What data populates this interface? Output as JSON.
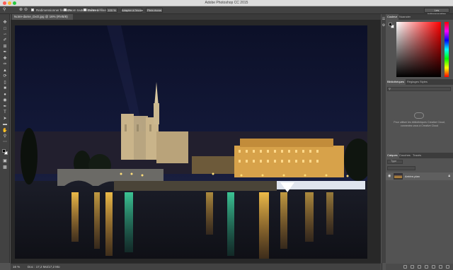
{
  "window": {
    "title": "Adobe Photoshop CC 2015"
  },
  "options_bar": {
    "resize_windows_label": "Redimensionner fenêtres",
    "zoom_all_windows_label": "Zoom toutes fenêtres",
    "scrubby_zoom_label": "Zoom défilant",
    "zoom_100_button": "100 %",
    "fit_screen_button": "Adapter à l'écran",
    "fill_screen_button": "Plein écran",
    "workspace_button": "Les indispensables"
  },
  "document": {
    "tab_label": "Notre-dame_DxO.jpg @ 16% (RVB/8)"
  },
  "status_bar": {
    "zoom": "16 %",
    "doc_info": "Doc : 17,2 Mo/17,2 Mo"
  },
  "color_panel": {
    "tabs": [
      "Couleur",
      "Nuancier"
    ],
    "foreground": "#000000",
    "background": "#ffffff",
    "hue_color": "#ff0000"
  },
  "libraries_panel": {
    "tabs": [
      "Bibliothèques",
      "Réglages",
      "Styles"
    ],
    "message": "Pour utiliser les bibliothèques Creative Cloud, connectez-vous à Creative Cloud"
  },
  "layers_panel": {
    "tabs": [
      "Calques",
      "Couches",
      "Tracés"
    ],
    "filter_label": "Type",
    "layer_name": "Arrière-plan"
  }
}
